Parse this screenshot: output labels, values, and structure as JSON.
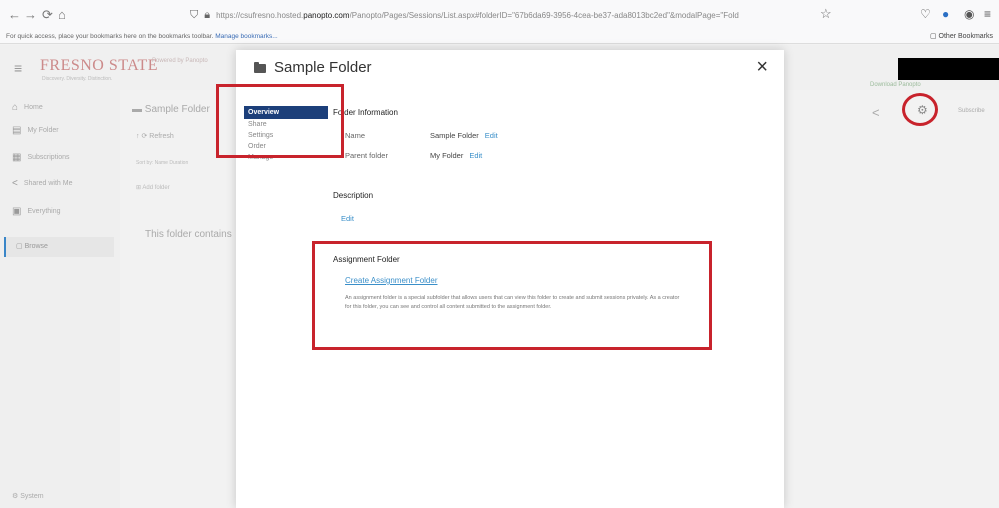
{
  "browser": {
    "back": "←",
    "forward": "→",
    "reload": "⟳",
    "home": "⌂",
    "url_prefix": "https://csufresno.hosted.",
    "url_domain": "panopto.com",
    "url_suffix": "/Panopto/Pages/Sessions/List.aspx#folderID=\"67b6da69-3956-4cea-be37-ada8013bc2ed\"&modalPage=\"Fold",
    "bookmarks_hint": "For quick access, place your bookmarks here on the bookmarks toolbar.",
    "manage_bookmarks": "Manage bookmarks...",
    "other_bookmarks": "Other Bookmarks"
  },
  "app": {
    "logo": "FRESNO STATE",
    "logo_sub": "Discovery. Diversity. Distinction.",
    "panopto_logo": "Powered by Panopto",
    "download_link": "Download Panopto",
    "subscribe": "Subscribe",
    "sidebar": {
      "items": [
        {
          "label": "Home",
          "icon": "⌂"
        },
        {
          "label": "My Folder",
          "icon": "▤"
        },
        {
          "label": "Subscriptions",
          "icon": "▦"
        },
        {
          "label": "Shared with Me",
          "icon": "<"
        },
        {
          "label": "Everything",
          "icon": "▣"
        }
      ],
      "browse": "Browse",
      "system": "System"
    },
    "main": {
      "title": "Sample Folder",
      "refresh": "Refresh",
      "sort": "Sort by: Name  Duration",
      "add": "Add folder",
      "empty_text": "This folder contains"
    }
  },
  "modal": {
    "title": "Sample Folder",
    "close": "×",
    "nav": [
      {
        "label": "Overview",
        "active": true
      },
      {
        "label": "Share",
        "active": false
      },
      {
        "label": "Settings",
        "active": false
      },
      {
        "label": "Order",
        "active": false
      },
      {
        "label": "Manage",
        "active": false
      }
    ],
    "folder_info": {
      "heading": "Folder Information",
      "name_label": "Name",
      "name_value": "Sample Folder",
      "parent_label": "Parent folder",
      "parent_value": "My Folder",
      "edit": "Edit"
    },
    "description": {
      "heading": "Description",
      "edit": "Edit"
    },
    "assignment": {
      "heading": "Assignment Folder",
      "create_link": "Create Assignment Folder",
      "text": "An assignment folder is a special subfolder that allows users that can view this folder to create and submit sessions privately. As a creator for this folder, you can see and control all content submitted to the assignment folder."
    }
  },
  "colors": {
    "annotation_red": "#c8232c",
    "nav_active": "#1c3f7a",
    "link_blue": "#3a8fc9"
  }
}
